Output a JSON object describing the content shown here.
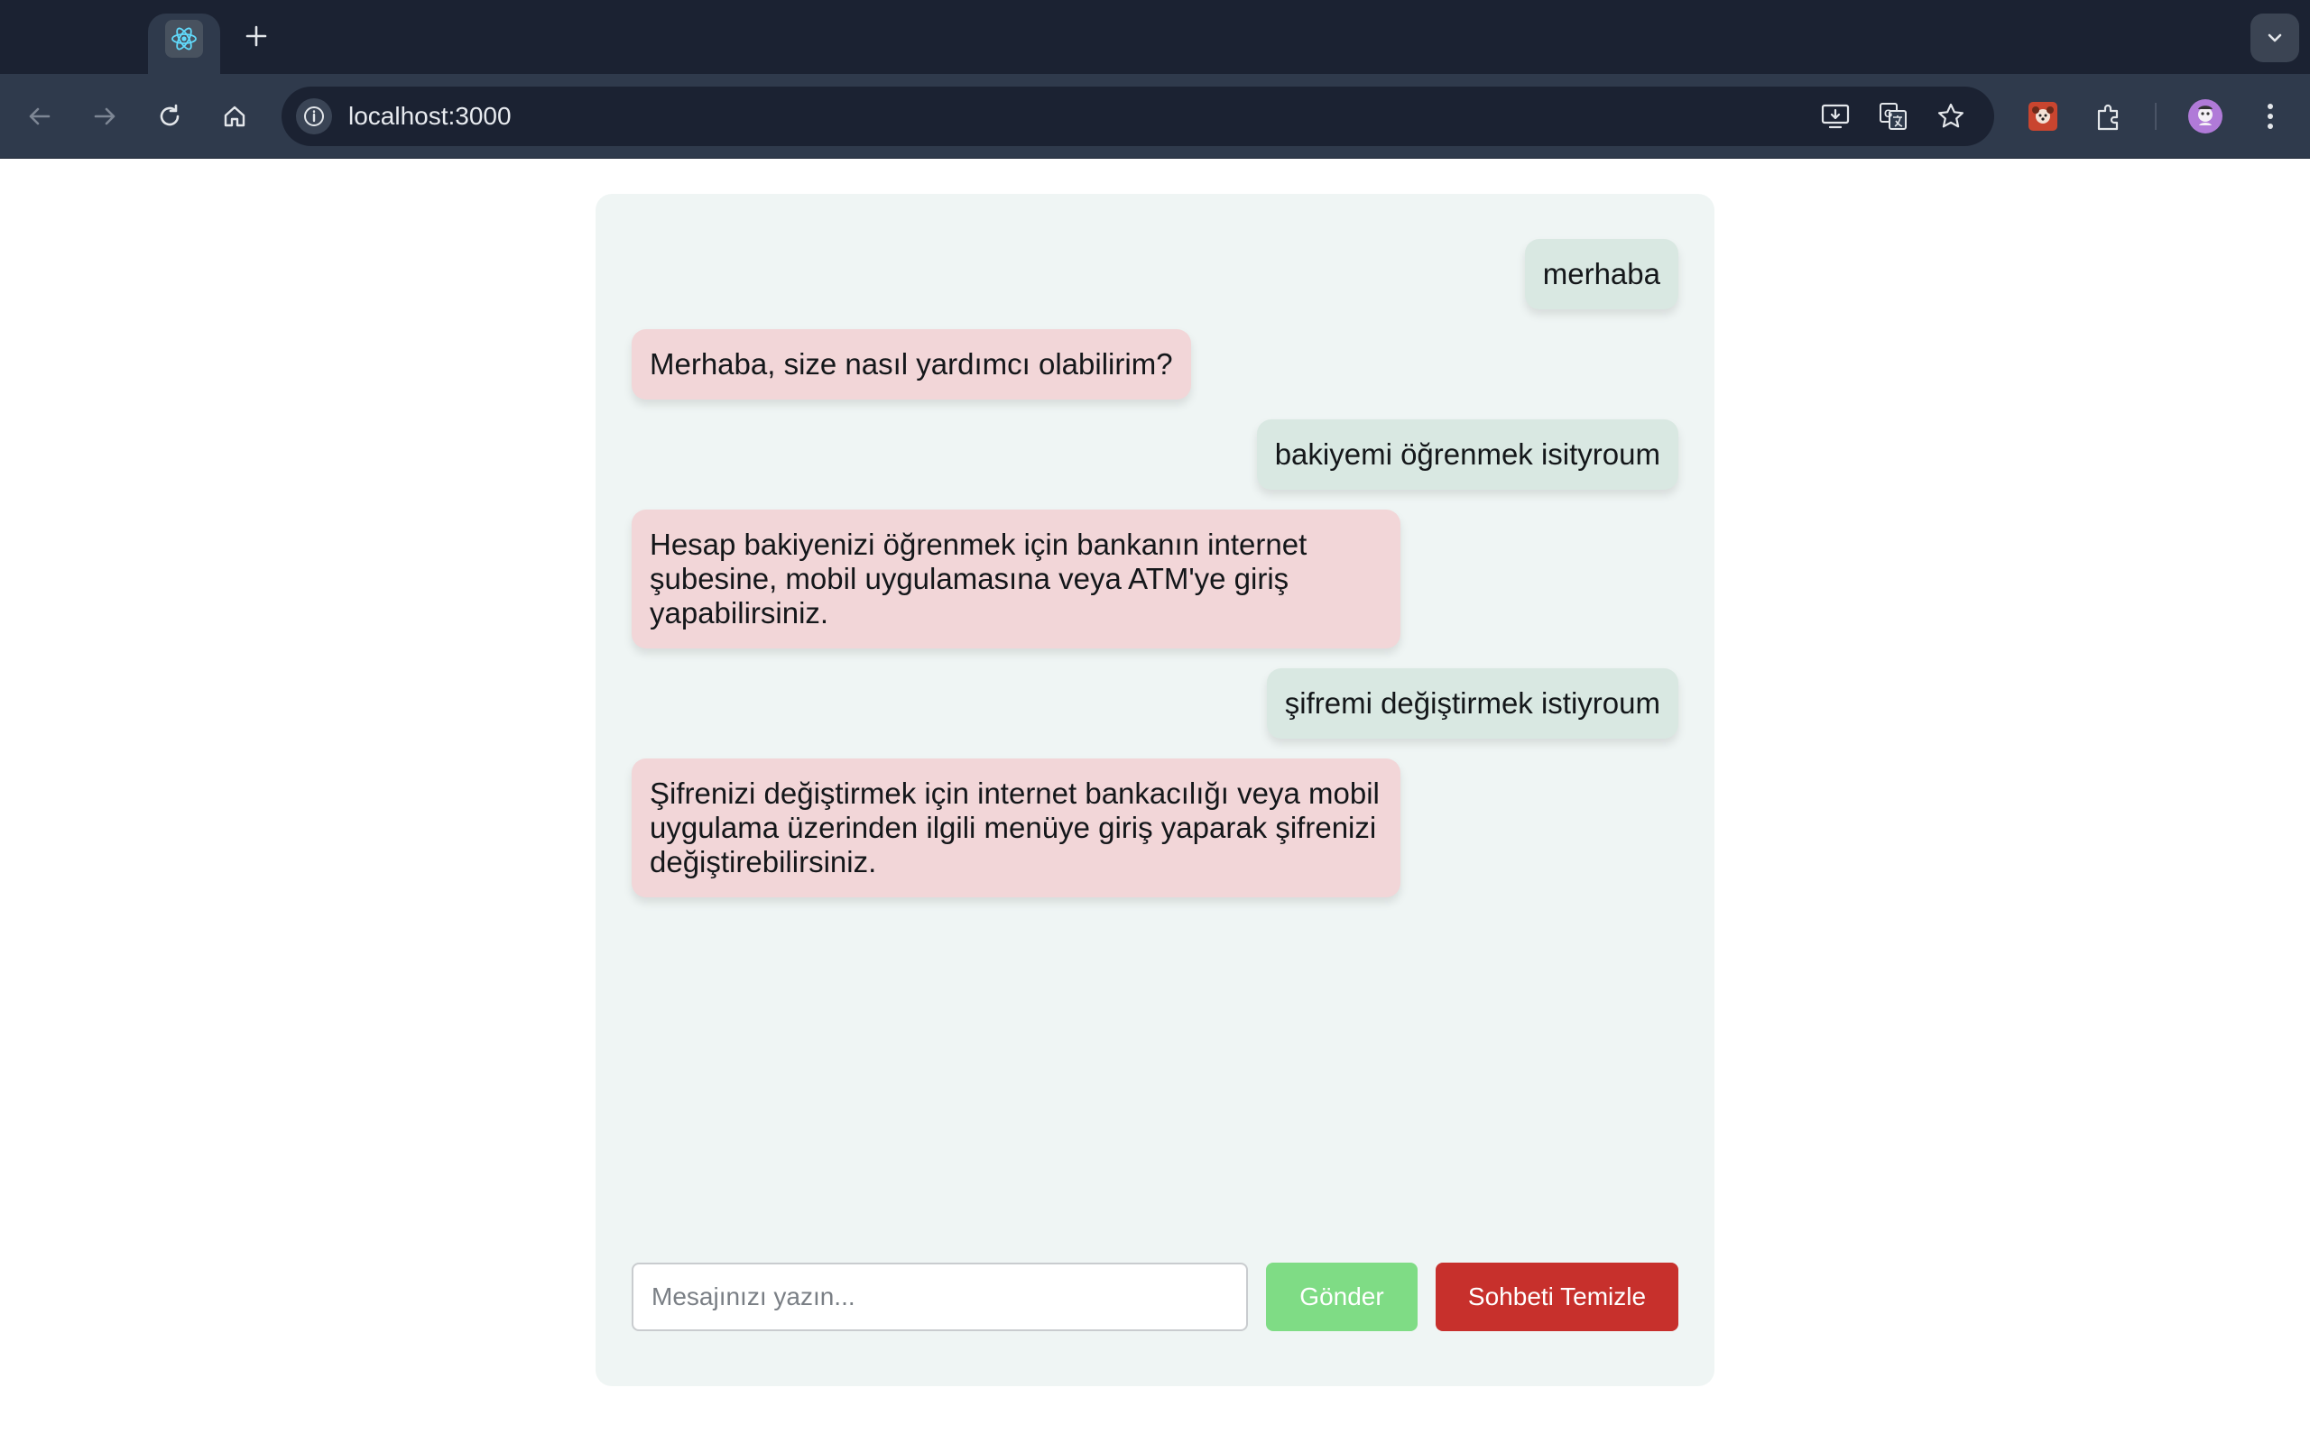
{
  "browser": {
    "tab_icon": "react-logo-icon",
    "new_tab_icon": "plus-icon",
    "tab_search_icon": "chevron-down-icon",
    "address": "localhost:3000",
    "colors": {
      "frame": "#1b2232",
      "toolbar": "#2f3a4c"
    }
  },
  "chat": {
    "messages": [
      {
        "role": "user",
        "text": "merhaba"
      },
      {
        "role": "bot",
        "text": "Merhaba, size nasıl yardımcı olabilirim?"
      },
      {
        "role": "user",
        "text": "bakiyemi öğrenmek isityroum"
      },
      {
        "role": "bot",
        "text": "Hesap bakiyenizi öğrenmek için bankanın internet şubesine, mobil uygulamasına veya ATM'ye giriş yapabilirsiniz."
      },
      {
        "role": "user",
        "text": "şifremi değiştirmek istiyroum"
      },
      {
        "role": "bot",
        "text": "Şifrenizi değiştirmek için internet bankacılığı veya mobil uygulama üzerinden ilgili menüye giriş yaparak şifrenizi değiştirebilirsiniz."
      }
    ],
    "input": {
      "placeholder": "Mesajınızı yazın...",
      "value": ""
    },
    "send_label": "Gönder",
    "clear_label": "Sohbeti Temizle",
    "colors": {
      "user_bubble": "#d9e8e2",
      "bot_bubble": "#f2d6d8",
      "send_button": "#7fdc85",
      "clear_button": "#c7302c",
      "panel": "#eff5f4"
    }
  }
}
